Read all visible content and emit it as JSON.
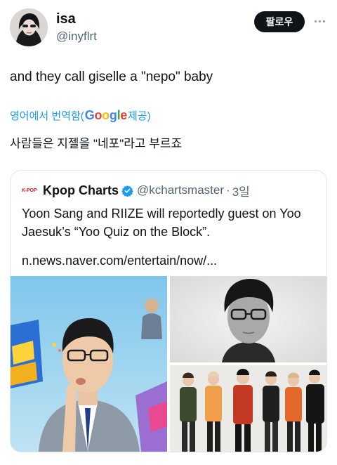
{
  "tweet": {
    "author_name": "isa",
    "author_handle": "@inyflrt",
    "follow_label": "팔로우",
    "text": "and they call giselle a \"nepo\" baby",
    "translate": {
      "prefix": "영어에서 번역함(",
      "google_letters": [
        "G",
        "o",
        "o",
        "g",
        "l",
        "e"
      ],
      "google_colors": [
        "#4285f4",
        "#ea4335",
        "#fbbc05",
        "#4285f4",
        "#34a853",
        "#ea4335"
      ],
      "suffix": " 제공)"
    },
    "translated_text": "사람들은 지젤을 \"네포\"라고 부르죠"
  },
  "quote": {
    "logo_text": "K-POP",
    "name": "Kpop Charts",
    "handle": "@kchartsmaster",
    "separator": "·",
    "time": "3일",
    "text": "Yoon Sang and RIIZE will reportedly guest on Yoo Jaesuk’s “Yoo Quiz on the Block”.",
    "link": "n.news.naver.com/entertain/now/..."
  },
  "icons": {
    "more": "more-dots-icon",
    "verified": "verified-badge-icon"
  },
  "colors": {
    "accent": "#1d9bf0",
    "text": "#0f1419",
    "muted": "#536471",
    "border": "#e1e6ea",
    "follow_bg": "#0f1419"
  }
}
